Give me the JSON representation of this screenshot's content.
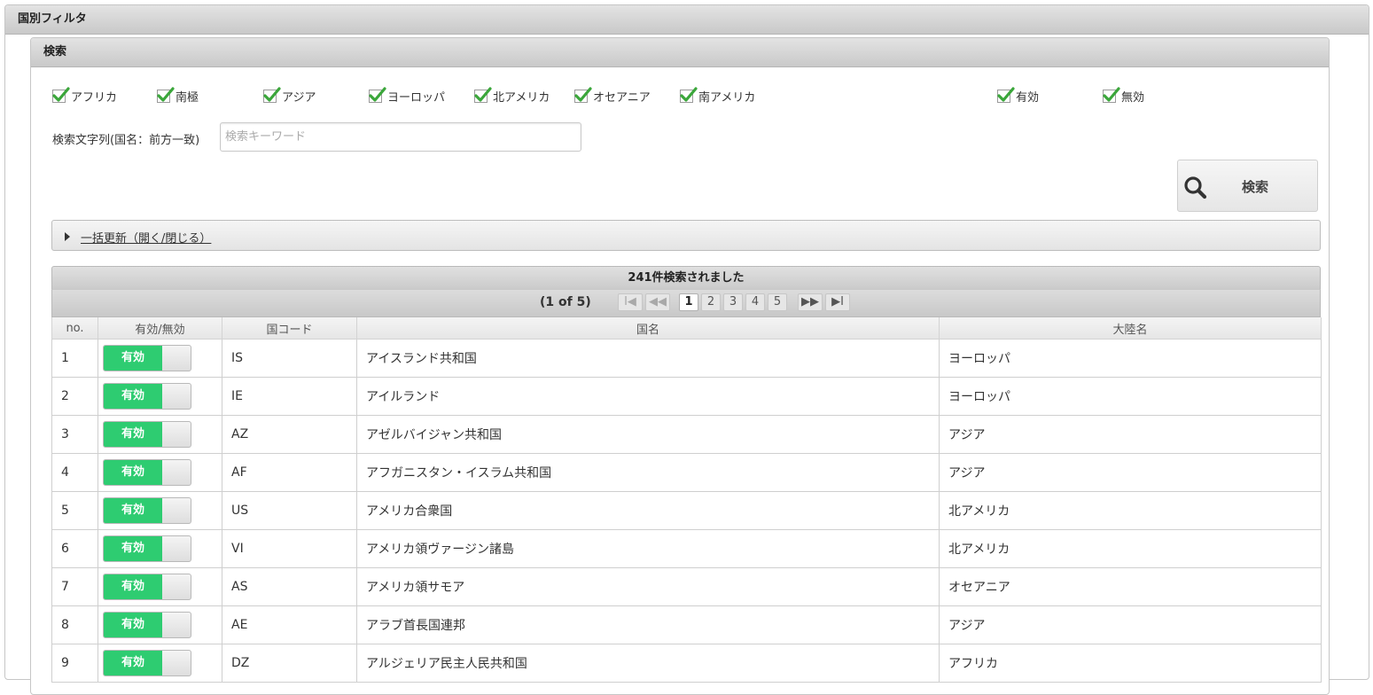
{
  "outer_title": "国別フィルタ",
  "search_panel": {
    "title": "検索",
    "continents": [
      {
        "label": "アフリカ",
        "checked": true
      },
      {
        "label": "南極",
        "checked": true
      },
      {
        "label": "アジア",
        "checked": true
      },
      {
        "label": "ヨーロッパ",
        "checked": true
      },
      {
        "label": "北アメリカ",
        "checked": true
      },
      {
        "label": "オセアニア",
        "checked": true
      },
      {
        "label": "南アメリカ",
        "checked": true
      }
    ],
    "status": [
      {
        "label": "有効",
        "checked": true
      },
      {
        "label": "無効",
        "checked": true
      }
    ],
    "search_label": "検索文字列(国名：前方一致)",
    "search_placeholder": "検索キーワード",
    "search_value": "",
    "search_button": "検索",
    "bulk_update": "一括更新（開く/閉じる）"
  },
  "results": {
    "title": "241件検索されました",
    "pager": {
      "info": "(1 of 5)",
      "first": "I◀",
      "prev": "◀◀",
      "pages": [
        "1",
        "2",
        "3",
        "4",
        "5"
      ],
      "current_page": "1",
      "next": "▶▶",
      "last": "▶I"
    },
    "columns": [
      "no.",
      "有効/無効",
      "国コード",
      "国名",
      "大陸名"
    ],
    "rows": [
      {
        "no": "1",
        "status": "有効",
        "code": "IS",
        "name": "アイスランド共和国",
        "continent": "ヨーロッパ"
      },
      {
        "no": "2",
        "status": "有効",
        "code": "IE",
        "name": "アイルランド",
        "continent": "ヨーロッパ"
      },
      {
        "no": "3",
        "status": "有効",
        "code": "AZ",
        "name": "アゼルバイジャン共和国",
        "continent": "アジア"
      },
      {
        "no": "4",
        "status": "有効",
        "code": "AF",
        "name": "アフガニスタン・イスラム共和国",
        "continent": "アジア"
      },
      {
        "no": "5",
        "status": "有効",
        "code": "US",
        "name": "アメリカ合衆国",
        "continent": "北アメリカ"
      },
      {
        "no": "6",
        "status": "有効",
        "code": "VI",
        "name": "アメリカ領ヴァージン諸島",
        "continent": "北アメリカ"
      },
      {
        "no": "7",
        "status": "有効",
        "code": "AS",
        "name": "アメリカ領サモア",
        "continent": "オセアニア"
      },
      {
        "no": "8",
        "status": "有効",
        "code": "AE",
        "name": "アラブ首長国連邦",
        "continent": "アジア"
      },
      {
        "no": "9",
        "status": "有効",
        "code": "DZ",
        "name": "アルジェリア民主人民共和国",
        "continent": "アフリカ"
      }
    ]
  },
  "colors": {
    "toggle_on": "#2ecc71",
    "check": "#3aa63a"
  }
}
